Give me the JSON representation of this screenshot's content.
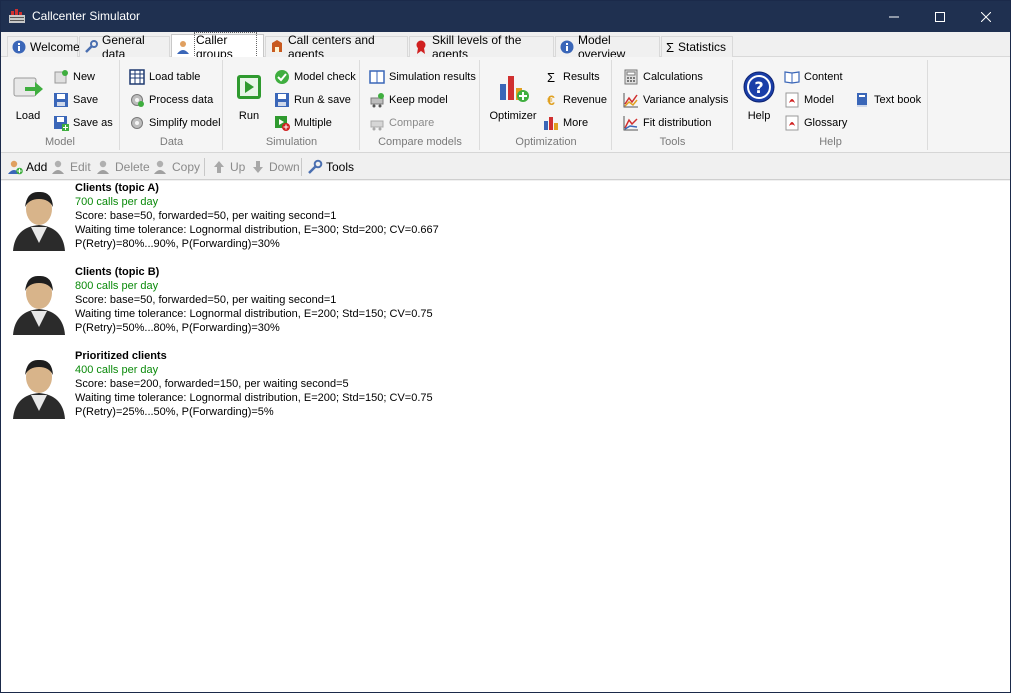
{
  "window": {
    "title": "Callcenter Simulator"
  },
  "tabs": [
    {
      "label": "Welcome",
      "icon": "info-icon"
    },
    {
      "label": "General data",
      "icon": "wrench-icon"
    },
    {
      "label": "Caller groups",
      "icon": "person-icon",
      "active": true
    },
    {
      "label": "Call centers and agents",
      "icon": "phone-icon"
    },
    {
      "label": "Skill levels of the agents",
      "icon": "ribbon-icon"
    },
    {
      "label": "Model overview",
      "icon": "info-icon"
    },
    {
      "label": "Statistics",
      "icon": "sigma-icon"
    }
  ],
  "ribbon": {
    "model": {
      "label": "Model",
      "load": "Load",
      "new": "New",
      "save": "Save",
      "save_as": "Save as"
    },
    "data": {
      "label": "Data",
      "load_table": "Load table",
      "process_data": "Process data",
      "simplify_model": "Simplify model"
    },
    "simulation": {
      "label": "Simulation",
      "run": "Run",
      "model_check": "Model check",
      "run_save": "Run & save",
      "multiple": "Multiple"
    },
    "compare": {
      "label": "Compare models",
      "sim_results": "Simulation results",
      "keep_model": "Keep model",
      "compare": "Compare"
    },
    "optimization": {
      "label": "Optimization",
      "optimizer": "Optimizer",
      "results": "Results",
      "revenue": "Revenue",
      "more": "More"
    },
    "tools": {
      "label": "Tools",
      "calculations": "Calculations",
      "variance": "Variance analysis",
      "fit": "Fit distribution"
    },
    "help": {
      "label": "Help",
      "help": "Help",
      "content": "Content",
      "model": "Model",
      "glossary": "Glossary",
      "textbook": "Text book"
    }
  },
  "toolbar": {
    "add": "Add",
    "edit": "Edit",
    "delete": "Delete",
    "copy": "Copy",
    "up": "Up",
    "down": "Down",
    "tools": "Tools"
  },
  "caller_groups": [
    {
      "name": "Clients (topic A)",
      "calls": "700 calls per day",
      "score": "Score: base=50, forwarded=50, per waiting second=1",
      "tolerance": "Waiting time tolerance: Lognormal distribution, E=300; Std=200; CV=0.667",
      "probabilities": "P(Retry)=80%...90%, P(Forwarding)=30%"
    },
    {
      "name": "Clients (topic B)",
      "calls": "800 calls per day",
      "score": "Score: base=50, forwarded=50, per waiting second=1",
      "tolerance": "Waiting time tolerance: Lognormal distribution, E=200; Std=150; CV=0.75",
      "probabilities": "P(Retry)=50%...80%, P(Forwarding)=30%"
    },
    {
      "name": "Prioritized clients",
      "calls": "400 calls per day",
      "score": "Score: base=200, forwarded=150, per waiting second=5",
      "tolerance": "Waiting time tolerance: Lognormal distribution, E=200; Std=150; CV=0.75",
      "probabilities": "P(Retry)=25%...50%, P(Forwarding)=5%"
    }
  ],
  "colors": {
    "titlebar": "#1f3050",
    "calls_text": "#0a8a0a"
  }
}
